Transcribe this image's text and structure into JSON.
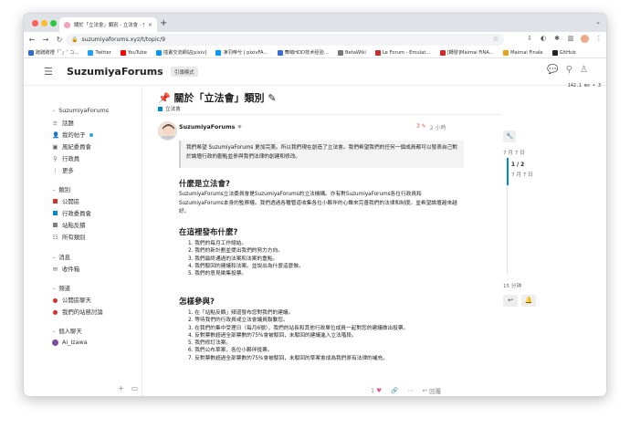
{
  "browser": {
    "tab_title": "關於「立法會」類別 - 立法會 - Su…",
    "tab_close": "×",
    "new_tab": "+",
    "url": "suzumiyaforums.xyz/t/topic/9",
    "bookmarks": [
      {
        "label": "蹭蹭蹭禮「ˇ」‘ コ…",
        "color": "#2b6bd8"
      },
      {
        "label": "Twitter",
        "color": "#1da1f2"
      },
      {
        "label": "YouTube",
        "color": "#ff0000"
      },
      {
        "label": "插畫交流網站[pixiv]",
        "color": "#0096fa"
      },
      {
        "label": "凍羽帝兮 | pixivFA…",
        "color": "#0096fa"
      },
      {
        "label": "舞萌HDD技术经验…",
        "color": "#3a6fd8"
      },
      {
        "label": "BetaWiki",
        "color": "#777777"
      },
      {
        "label": "Le Forum - Emulat…",
        "color": "#d02a2a"
      },
      {
        "label": "[轉發]Maimai FiNA…",
        "color": "#d02a2a"
      },
      {
        "label": "Maimai Finale",
        "color": "#e8a21a"
      },
      {
        "label": "GitHub",
        "color": "#222222"
      }
    ]
  },
  "header": {
    "site_title": "SuzumiyaForums",
    "guide_label": "引導模式",
    "stat_text": "142.1 ms • 3"
  },
  "sidebar": {
    "top": {
      "heading": "SuzumiyaForums",
      "items": [
        {
          "label": "話題",
          "icon": "≡"
        },
        {
          "label": "我的帖子",
          "icon": "👤"
        },
        {
          "label": "風紀委員會",
          "icon": "▣"
        },
        {
          "label": "行政員",
          "icon": "⚲"
        },
        {
          "label": "更多",
          "icon": "⋮"
        }
      ]
    },
    "categories": {
      "heading": "類別",
      "items": [
        {
          "label": "公開區",
          "color": "#d0312d"
        },
        {
          "label": "行政委員會",
          "color": "#0088cc"
        },
        {
          "label": "站點反饋",
          "color": "#808080"
        },
        {
          "label": "所有類別",
          "icon": "☷"
        }
      ]
    },
    "messages": {
      "heading": "消息",
      "items": [
        {
          "label": "收件箱",
          "icon": "✉"
        }
      ]
    },
    "channels": {
      "heading": "頻道",
      "items": [
        {
          "label": "公開區聊天",
          "color": "#d0312d"
        },
        {
          "label": "我們的站務討論",
          "color": "#d0312d"
        }
      ]
    },
    "dm": {
      "heading": "個人聊天",
      "items": [
        {
          "label": "Ai_Izawa"
        }
      ]
    }
  },
  "topic": {
    "title": "關於「立法會」類別",
    "category": "立法會",
    "category_color": "#0088cc",
    "post": {
      "username": "SuzumiyaForums",
      "edit_count": "3",
      "time_ago": "2 小時",
      "quote": "我們希望 SuzumiyaForums 更加完美。所以我們現在創造了立法會。我們希望我們的任何一個成員都可以發表自己對於論壇行政的觀點並參與我們法律的創建和修改。",
      "h1": "什麼是立法會?",
      "p1": "SuzumiyaForums立法委員會是SuzumiyaForums的立法機構。亦有對SuzumiyaForums各位行政員和SuzumiyaForums本身的監察權。我們透過各種管道收集各位小夥伴的心聲來完善我們的法律和制度。並希望論壇越來越好。",
      "h2": "在這裡發布什麼?",
      "list1": [
        "1. 我們的每月工作總結。",
        "2. 我們的新計劃並提出我們的努力方向。",
        "3. 我們最終通過的法案和法案的重點。",
        "4. 我們駁回的建議和法案。並說出為什麼這麼做。",
        "5. 我們的意見徵集投票。"
      ],
      "h3": "怎樣參與?",
      "list2": [
        "1. 在「站點反饋」頻道發布您對我們的建議。",
        "2. 等待我們的行政員或立法會議員聯繫您。",
        "3. 在我們的集中受理日（每月6號），我們的站長和其他行政單位成員一起對您的建議做出投票。",
        "4. 反對票數超過全部票數的75%會被駁回，未駁回的建議進入立法階段。",
        "5. 我們修訂法案。",
        "6. 我們公布草案，各位小夥伴投票。",
        "7. 反對票數超過全部票數的75%會被駁回，未駁回的草案會成為我們原有法律的補充。"
      ],
      "likes": "1",
      "reply_label": "回覆"
    }
  },
  "timeline": {
    "top_date": "7 月 7 日",
    "position": "1 / 2",
    "position_date": "7 月 7 日",
    "ago": "15 分钟"
  }
}
